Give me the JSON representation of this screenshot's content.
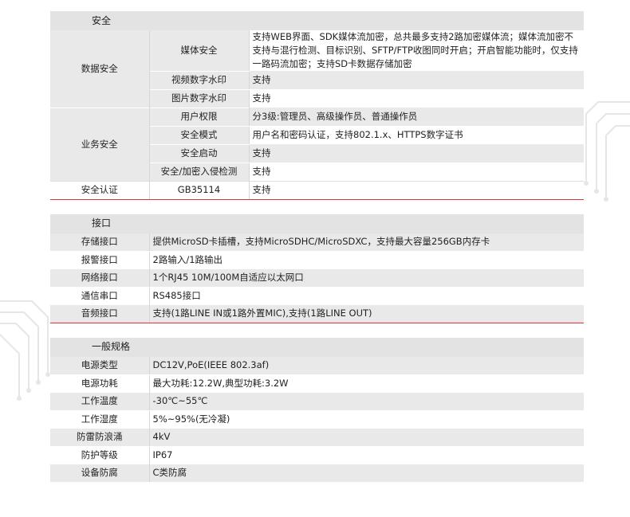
{
  "security": {
    "header": "安全",
    "rows": [
      {
        "group": "数据安全",
        "item": "媒体安全",
        "value": "支持WEB界面、SDK媒体流加密，总共最多支持2路加密媒体流；媒体流加密不支持与混行检测、目标识别、SFTP/FTP收图同时开启；开启智能功能时，仅支持一路码流加密；支持SD卡数据存储加密"
      },
      {
        "group": "",
        "item": "视频数字水印",
        "value": "支持"
      },
      {
        "group": "",
        "item": "图片数字水印",
        "value": "支持"
      },
      {
        "group": "业务安全",
        "item": "用户权限",
        "value": "分3级:管理员、高级操作员、普通操作员"
      },
      {
        "group": "",
        "item": "安全模式",
        "value": "用户名和密码认证，支持802.1.x、HTTPS数字证书"
      },
      {
        "group": "",
        "item": "安全启动",
        "value": "支持"
      },
      {
        "group": "",
        "item": "安全/加密入侵检测",
        "value": "支持"
      },
      {
        "group": "安全认证",
        "item": "GB35114",
        "value": "支持"
      }
    ]
  },
  "interface": {
    "header": "接口",
    "rows": [
      {
        "label": "存储接口",
        "value": "提供MicroSD卡插槽，支持MicroSDHC/MicroSDXC，支持最大容量256GB内存卡"
      },
      {
        "label": "报警接口",
        "value": "2路输入/1路输出"
      },
      {
        "label": "网络接口",
        "value": "1个RJ45 10M/100M自适应以太网口"
      },
      {
        "label": "通信串口",
        "value": "RS485接口"
      },
      {
        "label": "音频接口",
        "value": "支持(1路LINE IN或1路外置MIC),支持(1路LINE OUT)"
      }
    ]
  },
  "general": {
    "header": "一般规格",
    "rows": [
      {
        "label": "电源类型",
        "value": "DC12V,PoE(IEEE 802.3af)"
      },
      {
        "label": "电源功耗",
        "value": "最大功耗:12.2W,典型功耗:3.2W"
      },
      {
        "label": "工作温度",
        "value": "-30℃~55℃"
      },
      {
        "label": "工作湿度",
        "value": "5%~95%(无冷凝)"
      },
      {
        "label": "防雷防浪涌",
        "value": "4kV"
      },
      {
        "label": "防护等级",
        "value": "IP67"
      },
      {
        "label": "设备防腐",
        "value": "C类防腐"
      }
    ]
  },
  "colors": {
    "accent_red": "#d9363e",
    "header_grey": "#e3e3e3",
    "cell_grey": "#e9e9e9"
  }
}
